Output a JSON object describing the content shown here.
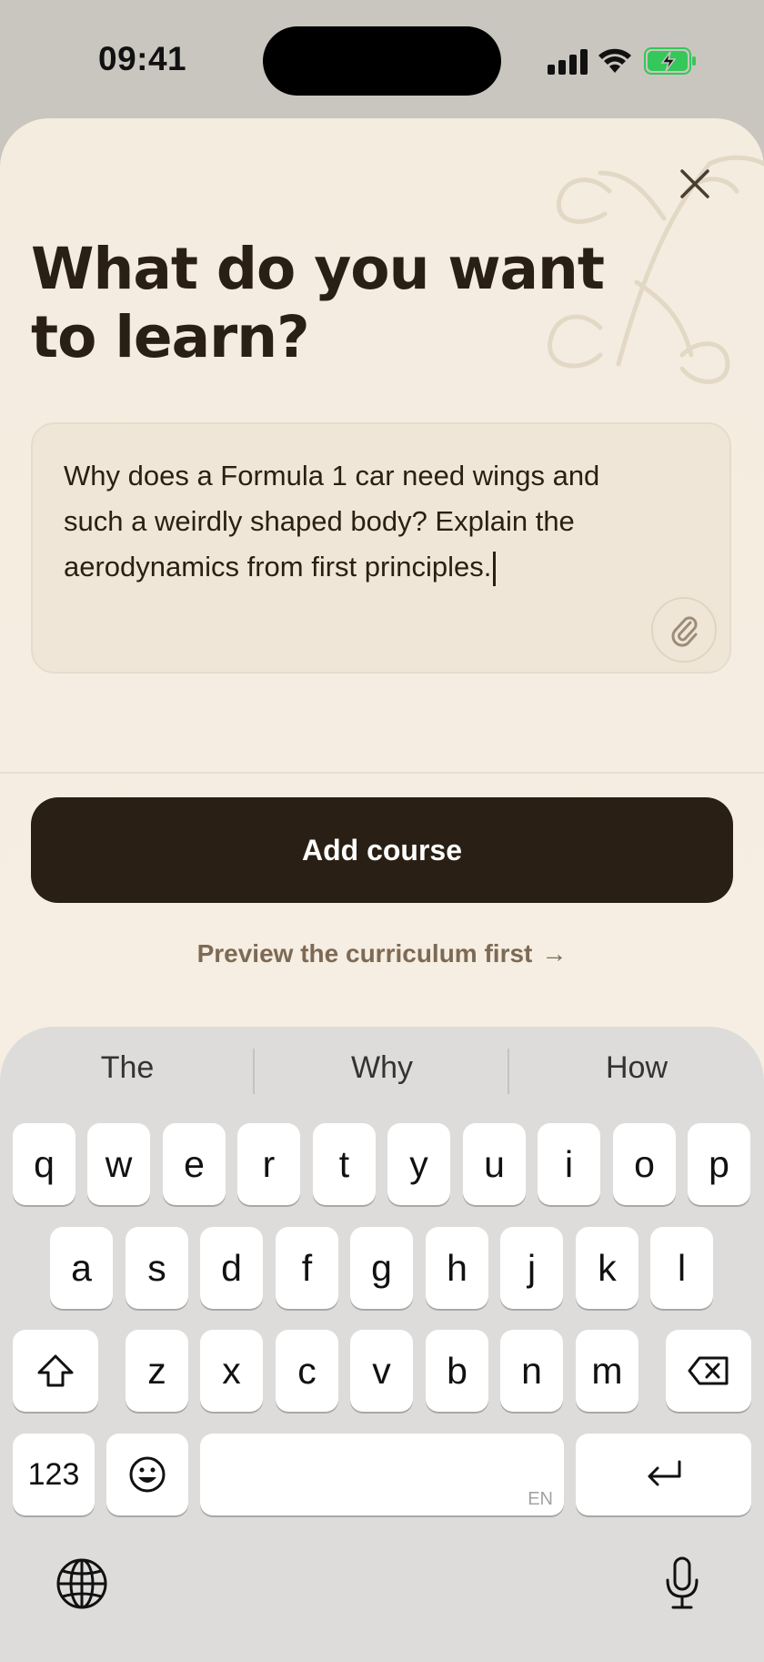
{
  "status_bar": {
    "time": "09:41",
    "battery_color": "#34c759"
  },
  "sheet": {
    "title": "What do you want to learn?",
    "input_value": "Why does a Formula 1 car need wings and such a weirdly shaped body? Explain the aerodynamics from first principles.",
    "input_lines": [
      "Why does a Formula 1 car need wings and",
      "such a weirdly shaped body? Explain the",
      "aerodynamics from first principles."
    ],
    "primary_button": "Add course",
    "secondary_link": "Preview the curriculum first",
    "secondary_arrow": "→",
    "accent_dark": "#2a1f14",
    "background": "#f4ecdf"
  },
  "keyboard": {
    "suggestions": [
      "The",
      "Why",
      "How"
    ],
    "row1": [
      "q",
      "w",
      "e",
      "r",
      "t",
      "y",
      "u",
      "i",
      "o",
      "p"
    ],
    "row2": [
      "a",
      "s",
      "d",
      "f",
      "g",
      "h",
      "j",
      "k",
      "l"
    ],
    "row3": [
      "z",
      "x",
      "c",
      "v",
      "b",
      "n",
      "m"
    ],
    "numbers_key": "123",
    "space_lang": "EN"
  }
}
